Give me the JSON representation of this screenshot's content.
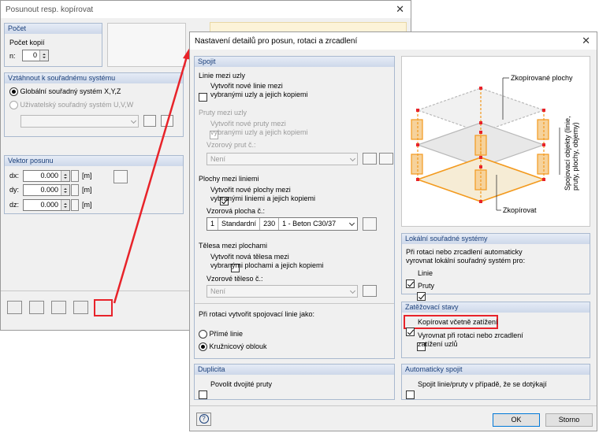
{
  "back_dialog": {
    "title": "Posunout resp. kopírovat",
    "pocet": {
      "header": "Počet",
      "label": "Počet kopií",
      "n_label": "n:",
      "n_value": "0"
    },
    "vztahnout": {
      "header": "Vztáhnout k souřadnému systému",
      "opt_global": "Globální souřadný systém X,Y,Z",
      "opt_user": "Uživatelský souřadný systém U,V,W"
    },
    "vektor": {
      "header": "Vektor posunu",
      "dx_label": "dx:",
      "dy_label": "dy:",
      "dz_label": "dz:",
      "dx": "0.000",
      "dy": "0.000",
      "dz": "0.000",
      "unit": "[m]"
    }
  },
  "dialog": {
    "title": "Nastavení detailů pro posun, rotaci a zrcadlení",
    "spojit": {
      "header": "Spojit",
      "linie_title": "Linie mezi uzly",
      "linie_check": "Vytvořit nové linie mezi vybranými uzly a jejich kopiemi",
      "linie_check_l1": "Vytvořit nové linie mezi",
      "linie_check_l2": "vybranými uzly a jejich kopiemi",
      "pruty_title": "Pruty mezi uzly",
      "pruty_check_l1": "Vytvořit nové pruty mezi",
      "pruty_check_l2": "vybranými uzly a jejich kopiemi",
      "vzorovy_prut": "Vzorový prut č.:",
      "prut_value": "Není",
      "plochy_title": "Plochy mezi liniemi",
      "plochy_check_l1": "Vytvořit nové plochy mezi",
      "plochy_check_l2": "vybranými liniemi a jejich kopiemi",
      "vzorova_plocha": "Vzorová plocha č.:",
      "plocha_num": "1",
      "plocha_type": "Standardní",
      "plocha_thk": "230",
      "plocha_mat": "1 - Beton C30/37",
      "telesa_title": "Tělesa mezi plochami",
      "telesa_check_l1": "Vytvořit nová tělesa mezi",
      "telesa_check_l2": "vybranými plochami a jejich kopiemi",
      "vzorove_teleso": "Vzorové těleso č.:",
      "teleso_value": "Není",
      "rotace_title": "Při rotaci vytvořit spojovací linie jako:",
      "opt_prime": "Přímé linie",
      "opt_kruh": "Kružnicový oblouk"
    },
    "diagram": {
      "top_label": "Zkopírované plochy",
      "side_label_l1": "Spojovací objekty (linie,",
      "side_label_l2": "pruty, plochy, objemy)",
      "bottom_label": "Zkopírovat"
    },
    "lokalni": {
      "header": "Lokální souřadné systémy",
      "text_l1": "Při rotaci nebo zrcadlení automaticky",
      "text_l2": "vyrovnat lokální souřadný systém pro:",
      "linie": "Linie",
      "pruty": "Pruty"
    },
    "zatezovaci": {
      "header": "Zatěžovací stavy",
      "kopirovat": "Kopírovat včetně zatížení",
      "vyrovnat_l1": "Vyrovnat při rotaci nebo zrcadlení",
      "vyrovnat_l2": "zatížení uzlů"
    },
    "duplicita": {
      "header": "Duplicita",
      "check": "Povolit dvojité pruty"
    },
    "auto": {
      "header": "Automaticky spojit",
      "check": "Spojit linie/pruty v případě, že se dotýkají"
    },
    "ok": "OK",
    "cancel": "Storno"
  },
  "colors": {
    "accent": "#e8232a",
    "group_header": "#1a3f7a",
    "diagram_orange": "#f39a1e"
  }
}
